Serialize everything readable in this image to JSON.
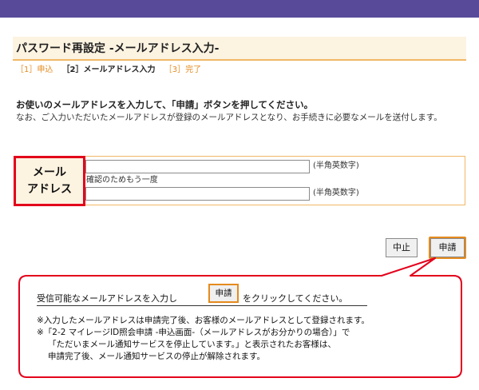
{
  "header": {
    "title": "パスワード再設定 -メールアドレス入力-"
  },
  "steps": [
    {
      "label": "［1］申込",
      "active": false
    },
    {
      "label": "［2］メールアドレス入力",
      "active": true
    },
    {
      "label": "［3］完了",
      "active": false
    }
  ],
  "instruction": "お使いのメールアドレスを入力して、「申請」ボタンを押してください。",
  "note": "なお、ご入力いただいたメールアドレスが登録のメールアドレスとなり、お手続きに必要なメールを送付します。",
  "form": {
    "label_line1": "メール",
    "label_line2": "アドレス",
    "email_value": "",
    "confirm_label": "確認のためもう一度",
    "confirm_value": "",
    "hint": "(半角英数字)"
  },
  "buttons": {
    "cancel": "中止",
    "apply": "申請"
  },
  "callout": {
    "line1_before": "受信可能なメールアドレスを入力し",
    "button": "申請",
    "line1_after": "をクリックしてください。",
    "notes": [
      "※入力したメールアドレスは申請完了後、お客様のメールアドレスとして登録されます。",
      "※「2-2 マイレージID照会申請 -申込画面-（メールアドレスがお分かりの場合）」で",
      "「ただいまメール通知サービスを停止しています。」と表示されたお客様は、",
      "申請完了後、メール通知サービスの停止が解除されます。"
    ]
  },
  "colors": {
    "topbar": "#584a98",
    "accent_orange": "#e48b1e",
    "highlight_red": "#e3001b"
  }
}
